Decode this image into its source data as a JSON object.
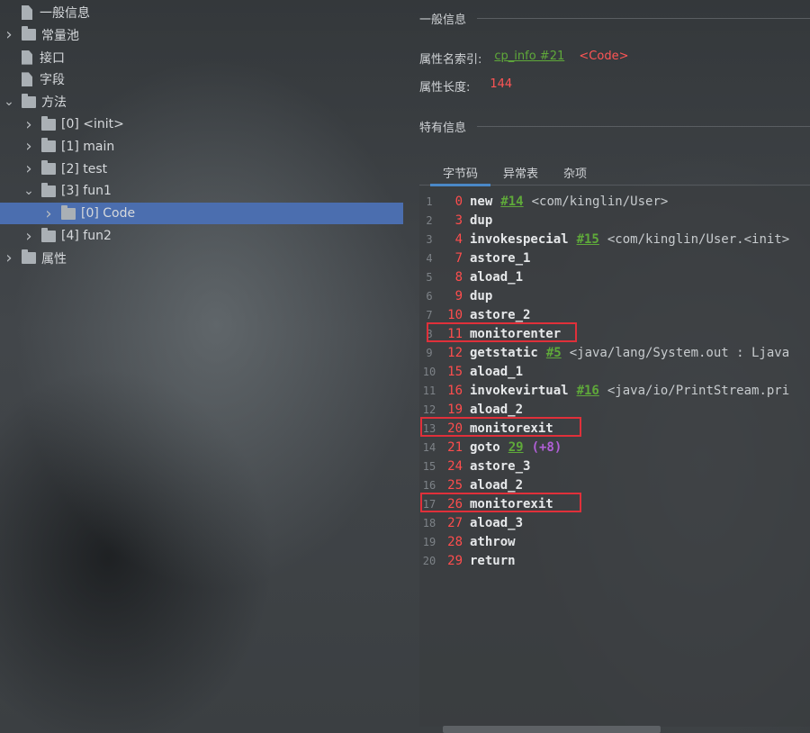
{
  "tree": [
    {
      "label": "一般信息",
      "expanded": null,
      "icon": "file-icon"
    },
    {
      "label": "常量池",
      "expanded": false,
      "icon": "folder-icon"
    },
    {
      "label": "接口",
      "expanded": null,
      "icon": "file-icon"
    },
    {
      "label": "字段",
      "expanded": null,
      "icon": "file-icon"
    },
    {
      "label": "方法",
      "expanded": true,
      "icon": "folder-icon"
    },
    {
      "label": "[0] <init>",
      "expanded": false,
      "icon": "folder-icon"
    },
    {
      "label": "[1] main",
      "expanded": false,
      "icon": "folder-icon"
    },
    {
      "label": "[2] test",
      "expanded": false,
      "icon": "folder-icon"
    },
    {
      "label": "[3] fun1",
      "expanded": true,
      "icon": "folder-icon"
    },
    {
      "label": "[0] Code",
      "expanded": false,
      "icon": "folder-icon",
      "selected": true
    },
    {
      "label": "[4] fun2",
      "expanded": false,
      "icon": "folder-icon"
    },
    {
      "label": "属性",
      "expanded": false,
      "icon": "folder-icon"
    }
  ],
  "general": {
    "section_title": "一般信息",
    "name_index_label": "属性名索引:",
    "name_index_link": "cp_info #21",
    "name_index_value": "<Code>",
    "length_label": "属性长度:",
    "length_value": "144"
  },
  "specific": {
    "section_title": "特有信息"
  },
  "tabs": [
    "字节码",
    "异常表",
    "杂项"
  ],
  "active_tab": "字节码",
  "bytecode": [
    {
      "line": "1",
      "offset": "0",
      "op": "new",
      "ref": "#14",
      "comment": "<com/kinglin/User>"
    },
    {
      "line": "2",
      "offset": "3",
      "op": "dup"
    },
    {
      "line": "3",
      "offset": "4",
      "op": "invokespecial",
      "ref": "#15",
      "comment": "<com/kinglin/User.<init>"
    },
    {
      "line": "4",
      "offset": "7",
      "op": "astore_1"
    },
    {
      "line": "5",
      "offset": "8",
      "op": "aload_1"
    },
    {
      "line": "6",
      "offset": "9",
      "op": "dup"
    },
    {
      "line": "7",
      "offset": "10",
      "op": "astore_2"
    },
    {
      "line": "8",
      "offset": "11",
      "op": "monitorenter",
      "highlight": true
    },
    {
      "line": "9",
      "offset": "12",
      "op": "getstatic",
      "ref": "#5",
      "comment": "<java/lang/System.out : Ljava"
    },
    {
      "line": "10",
      "offset": "15",
      "op": "aload_1"
    },
    {
      "line": "11",
      "offset": "16",
      "op": "invokevirtual",
      "ref": "#16",
      "comment": "<java/io/PrintStream.pri"
    },
    {
      "line": "12",
      "offset": "19",
      "op": "aload_2"
    },
    {
      "line": "13",
      "offset": "20",
      "op": "monitorexit",
      "highlight": true
    },
    {
      "line": "14",
      "offset": "21",
      "op": "goto",
      "ref": "29",
      "comment_purple": "(+8)"
    },
    {
      "line": "15",
      "offset": "24",
      "op": "astore_3"
    },
    {
      "line": "16",
      "offset": "25",
      "op": "aload_2"
    },
    {
      "line": "17",
      "offset": "26",
      "op": "monitorexit",
      "highlight": true
    },
    {
      "line": "18",
      "offset": "27",
      "op": "aload_3"
    },
    {
      "line": "19",
      "offset": "28",
      "op": "athrow"
    },
    {
      "line": "20",
      "offset": "29",
      "op": "return"
    }
  ],
  "colors": {
    "selection": "#4b6eaf",
    "offset": "#ff4d4d",
    "link": "#5fa93a",
    "highlight_box": "#e0303a",
    "purple": "#b05fd6"
  }
}
